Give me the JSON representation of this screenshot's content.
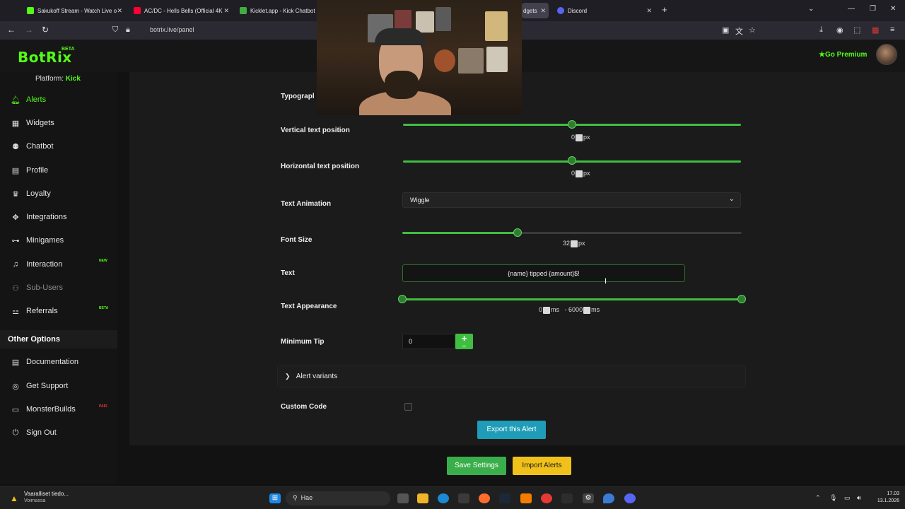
{
  "browser": {
    "tabs": [
      {
        "label": "Sakukoff Stream - Watch Live o",
        "favicon_color": "#53fc18"
      },
      {
        "label": "AC/DC - Hells Bells (Official 4K",
        "favicon_color": "#ff0033"
      },
      {
        "label": "Kicklet.app - Kick Chatbot a",
        "favicon_color": "#3fae3f"
      },
      {
        "label": "dgets",
        "favicon_color": "#53fc18"
      },
      {
        "label": "Discord",
        "favicon_color": "#5865f2"
      }
    ],
    "url": "botrix.live/panel"
  },
  "header": {
    "logo": "BotRix",
    "logo_badge": "BETA",
    "premium": "Go Premium"
  },
  "sidebar": {
    "platform_label": "Platform:",
    "platform_value": "Kick",
    "items": [
      {
        "label": "Alerts",
        "icon": "bell-icon"
      },
      {
        "label": "Widgets",
        "icon": "grid-icon"
      },
      {
        "label": "Chatbot",
        "icon": "robot-icon"
      },
      {
        "label": "Profile",
        "icon": "id-card-icon"
      },
      {
        "label": "Loyalty",
        "icon": "trophy-icon"
      },
      {
        "label": "Integrations",
        "icon": "puzzle-icon"
      },
      {
        "label": "Minigames",
        "icon": "gamepad-icon"
      },
      {
        "label": "Interaction",
        "icon": "music-icon",
        "badge": "NEW"
      },
      {
        "label": "Sub-Users",
        "icon": "users-icon"
      },
      {
        "label": "Referrals",
        "icon": "user-plus-icon",
        "badge": "BETA"
      }
    ],
    "other_header": "Other Options",
    "other_items": [
      {
        "label": "Documentation",
        "icon": "book-icon"
      },
      {
        "label": "Get Support",
        "icon": "support-icon"
      },
      {
        "label": "MonsterBuilds",
        "icon": "monitor-icon",
        "badge": "PAID"
      },
      {
        "label": "Sign Out",
        "icon": "power-icon"
      }
    ],
    "badge_colors": {
      "NEW": "#53fc18",
      "BETA": "#53fc18",
      "PAID": "#e53935"
    }
  },
  "form": {
    "typography_label": "Typograpl",
    "vertical": {
      "label": "Vertical text position",
      "value": "0",
      "unit": "px",
      "fraction": 0.5
    },
    "horizontal": {
      "label": "Horizontal text position",
      "value": "0",
      "unit": "px",
      "fraction": 0.5
    },
    "animation": {
      "label": "Text Animation",
      "value": "Wiggle"
    },
    "font_size": {
      "label": "Font Size",
      "value": "32",
      "unit": "px",
      "fraction": 0.34
    },
    "text": {
      "label": "Text",
      "value": "{name} tipped {amount}$!"
    },
    "appearance": {
      "label": "Text Appearance",
      "min_value": "0",
      "min_unit": "ms",
      "sep": "-",
      "max_value": "6000",
      "max_unit": "ms"
    },
    "minimum_tip": {
      "label": "Minimum Tip",
      "value": "0"
    },
    "variants": {
      "label": "Alert variants"
    },
    "custom_code": {
      "label": "Custom Code"
    },
    "export_label": "Export this Alert",
    "save_label": "Save Settings",
    "import_label": "Import Alerts"
  },
  "taskbar": {
    "notice_title": "Vaaralliset tiedo...",
    "notice_sub": "Voimassa",
    "search_placeholder": "Hae",
    "time": "17.03",
    "date": "13.1.2026"
  },
  "colors": {
    "accent": "#53fc18",
    "slider_active": "#3fbf3f",
    "slider_inactive": "#3a3a3a"
  }
}
